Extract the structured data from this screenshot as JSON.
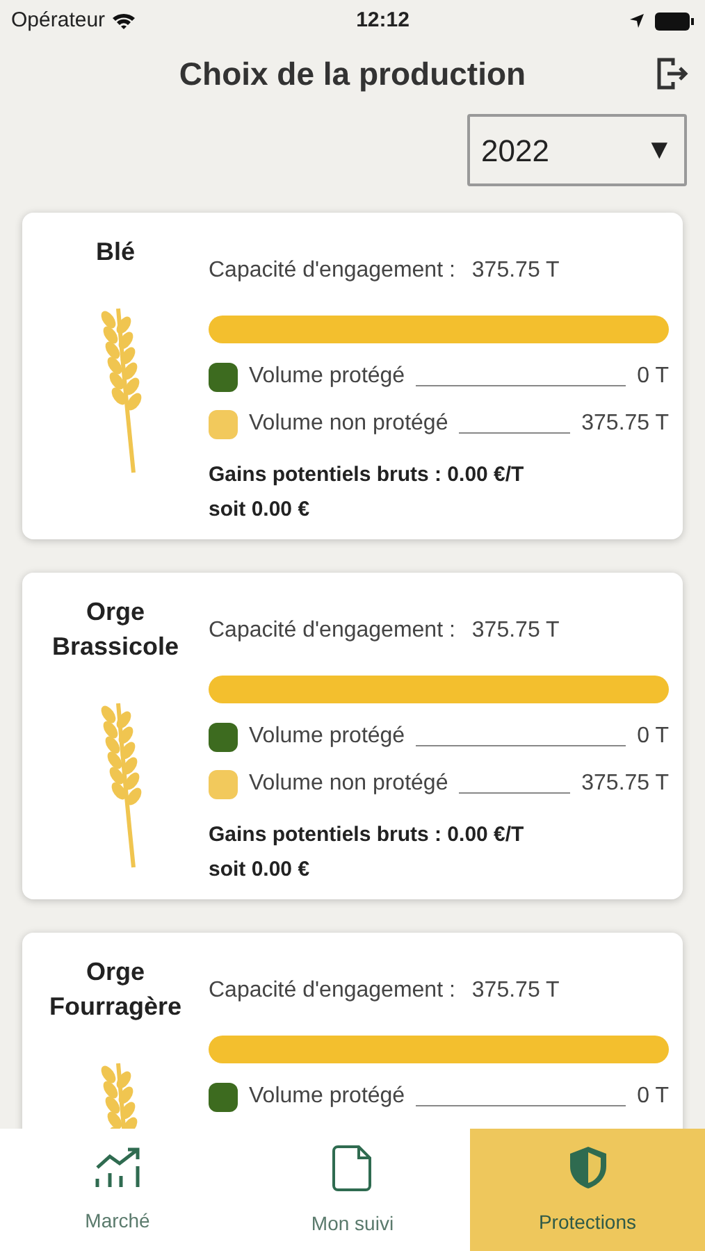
{
  "status_bar": {
    "carrier": "Opérateur",
    "time": "12:12"
  },
  "header": {
    "title": "Choix de la production"
  },
  "year_select": {
    "value": "2022",
    "arrow": "▼"
  },
  "cards": [
    {
      "name": "Blé",
      "capacity_label": "Capacité d'engagement :",
      "capacity_value": "375.75 T",
      "level": 0,
      "legend": [
        {
          "label": "Volume protégé",
          "value": "0 T",
          "color": "#3d6b1f"
        },
        {
          "label": "Volume non protégé",
          "value": "375.75 T",
          "color": "#f2c95c"
        }
      ],
      "gains": "Gains potentiels bruts : 0.00 €/T",
      "total": "soit 0.00 €"
    },
    {
      "name": "Orge Brassicole",
      "capacity_label": "Capacité d'engagement :",
      "capacity_value": "375.75 T",
      "level": 0,
      "legend": [
        {
          "label": "Volume protégé",
          "value": "0 T",
          "color": "#3d6b1f"
        },
        {
          "label": "Volume non protégé",
          "value": "375.75 T",
          "color": "#f2c95c"
        }
      ],
      "gains": "Gains potentiels bruts : 0.00 €/T",
      "total": "soit 0.00 €"
    },
    {
      "name": "Orge Fourragère",
      "capacity_label": "Capacité d'engagement :",
      "capacity_value": "375.75 T",
      "level": 0,
      "legend": [
        {
          "label": "Volume protégé",
          "value": "0 T",
          "color": "#3d6b1f"
        }
      ]
    }
  ],
  "tabs": [
    {
      "label": "Marché",
      "kind": "chart",
      "selected": false
    },
    {
      "label": "Mon suivi",
      "kind": "document",
      "selected": false
    },
    {
      "label": "Protections",
      "kind": "shield",
      "selected": true
    }
  ]
}
